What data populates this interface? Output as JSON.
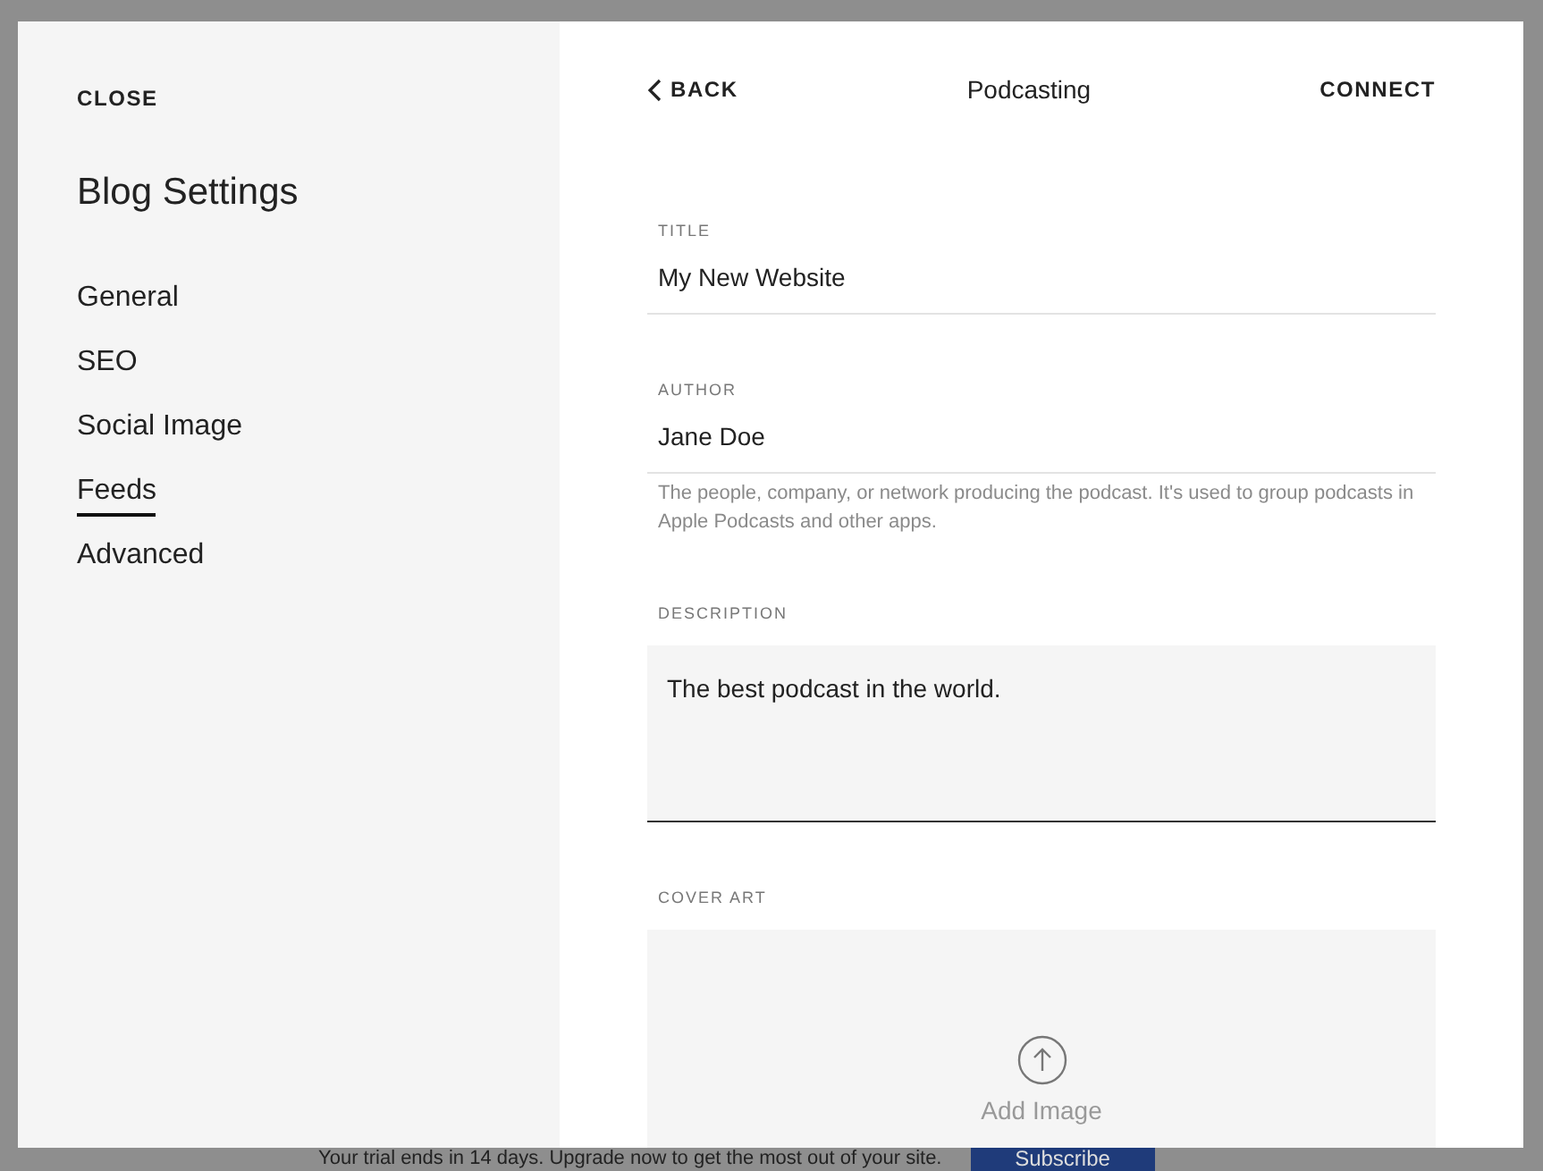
{
  "sidebar": {
    "close": "CLOSE",
    "title": "Blog Settings",
    "items": [
      {
        "label": "General",
        "selected": false
      },
      {
        "label": "SEO",
        "selected": false
      },
      {
        "label": "Social Image",
        "selected": false
      },
      {
        "label": "Feeds",
        "selected": true
      },
      {
        "label": "Advanced",
        "selected": false
      }
    ]
  },
  "header": {
    "back": "BACK",
    "title": "Podcasting",
    "action": "CONNECT"
  },
  "fields": [
    {
      "kind": "text",
      "label": "TITLE",
      "value": "My New Website"
    },
    {
      "kind": "text",
      "label": "AUTHOR",
      "value": "Jane Doe",
      "help": "The people, company, or network producing the podcast. It's used to group podcasts in Apple Podcasts and other apps."
    },
    {
      "kind": "textarea",
      "label": "DESCRIPTION",
      "value": "The best podcast in the world."
    },
    {
      "kind": "image",
      "label": "COVER ART",
      "button": "Add Image"
    }
  ],
  "banner": {
    "text": "Your trial ends in 14 days. Upgrade now to get the most out of your site.",
    "button": "Subscribe"
  }
}
